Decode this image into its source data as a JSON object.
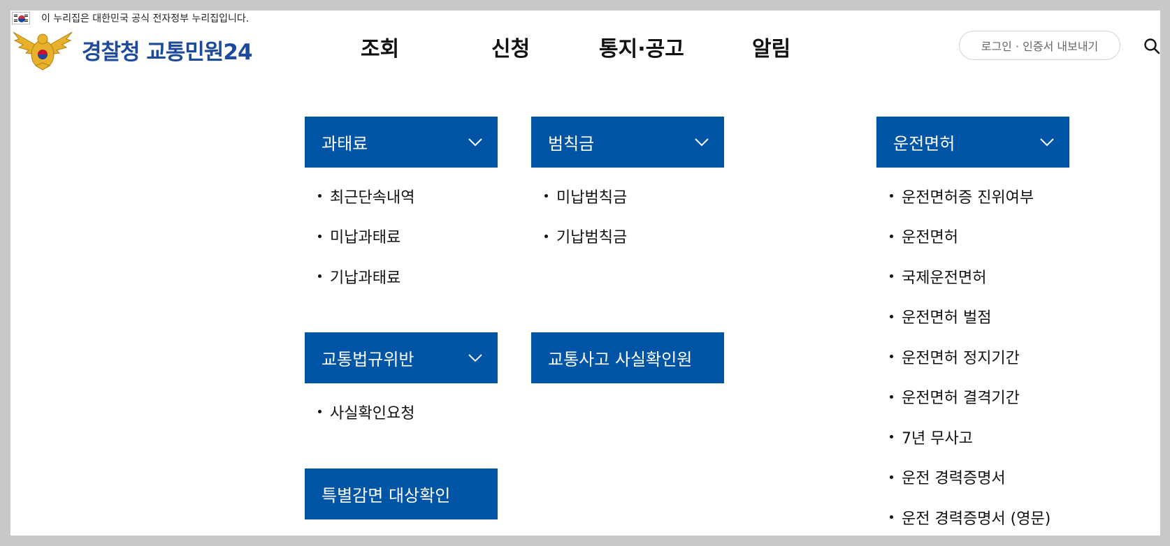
{
  "gov_banner": {
    "text": "이 누리집은 대한민국 공식 전자정부 누리집입니다."
  },
  "logo": {
    "text": "경찰청 교통민원24"
  },
  "gnb": [
    {
      "label": "조회"
    },
    {
      "label": "신청"
    },
    {
      "label": "통지·공고"
    },
    {
      "label": "알림"
    }
  ],
  "header": {
    "login_label": "로그인 · 인증서 내보내기"
  },
  "menus": {
    "fine": {
      "title": "과태료",
      "items": [
        "최근단속내역",
        "미납과태료",
        "기납과태료"
      ]
    },
    "penalty": {
      "title": "범칙금",
      "items": [
        "미납범칙금",
        "기납범칙금"
      ]
    },
    "violation": {
      "title": "교통법규위반",
      "items": [
        "사실확인요청"
      ]
    },
    "accident": {
      "title": "교통사고 사실확인원"
    },
    "special": {
      "title": "특별감면 대상확인"
    },
    "license": {
      "title": "운전면허",
      "items": [
        "운전면허증 진위여부",
        "운전면허",
        "국제운전면허",
        "운전면허 벌점",
        "운전면허 정지기간",
        "운전면허 결격기간",
        "7년 무사고",
        "운전 경력증명서",
        "운전 경력증명서 (영문)"
      ]
    }
  },
  "colors": {
    "menu_header_bg": "#0054a6",
    "logo_text": "#1d4a9c",
    "page_frame": "#c8c8c8"
  }
}
